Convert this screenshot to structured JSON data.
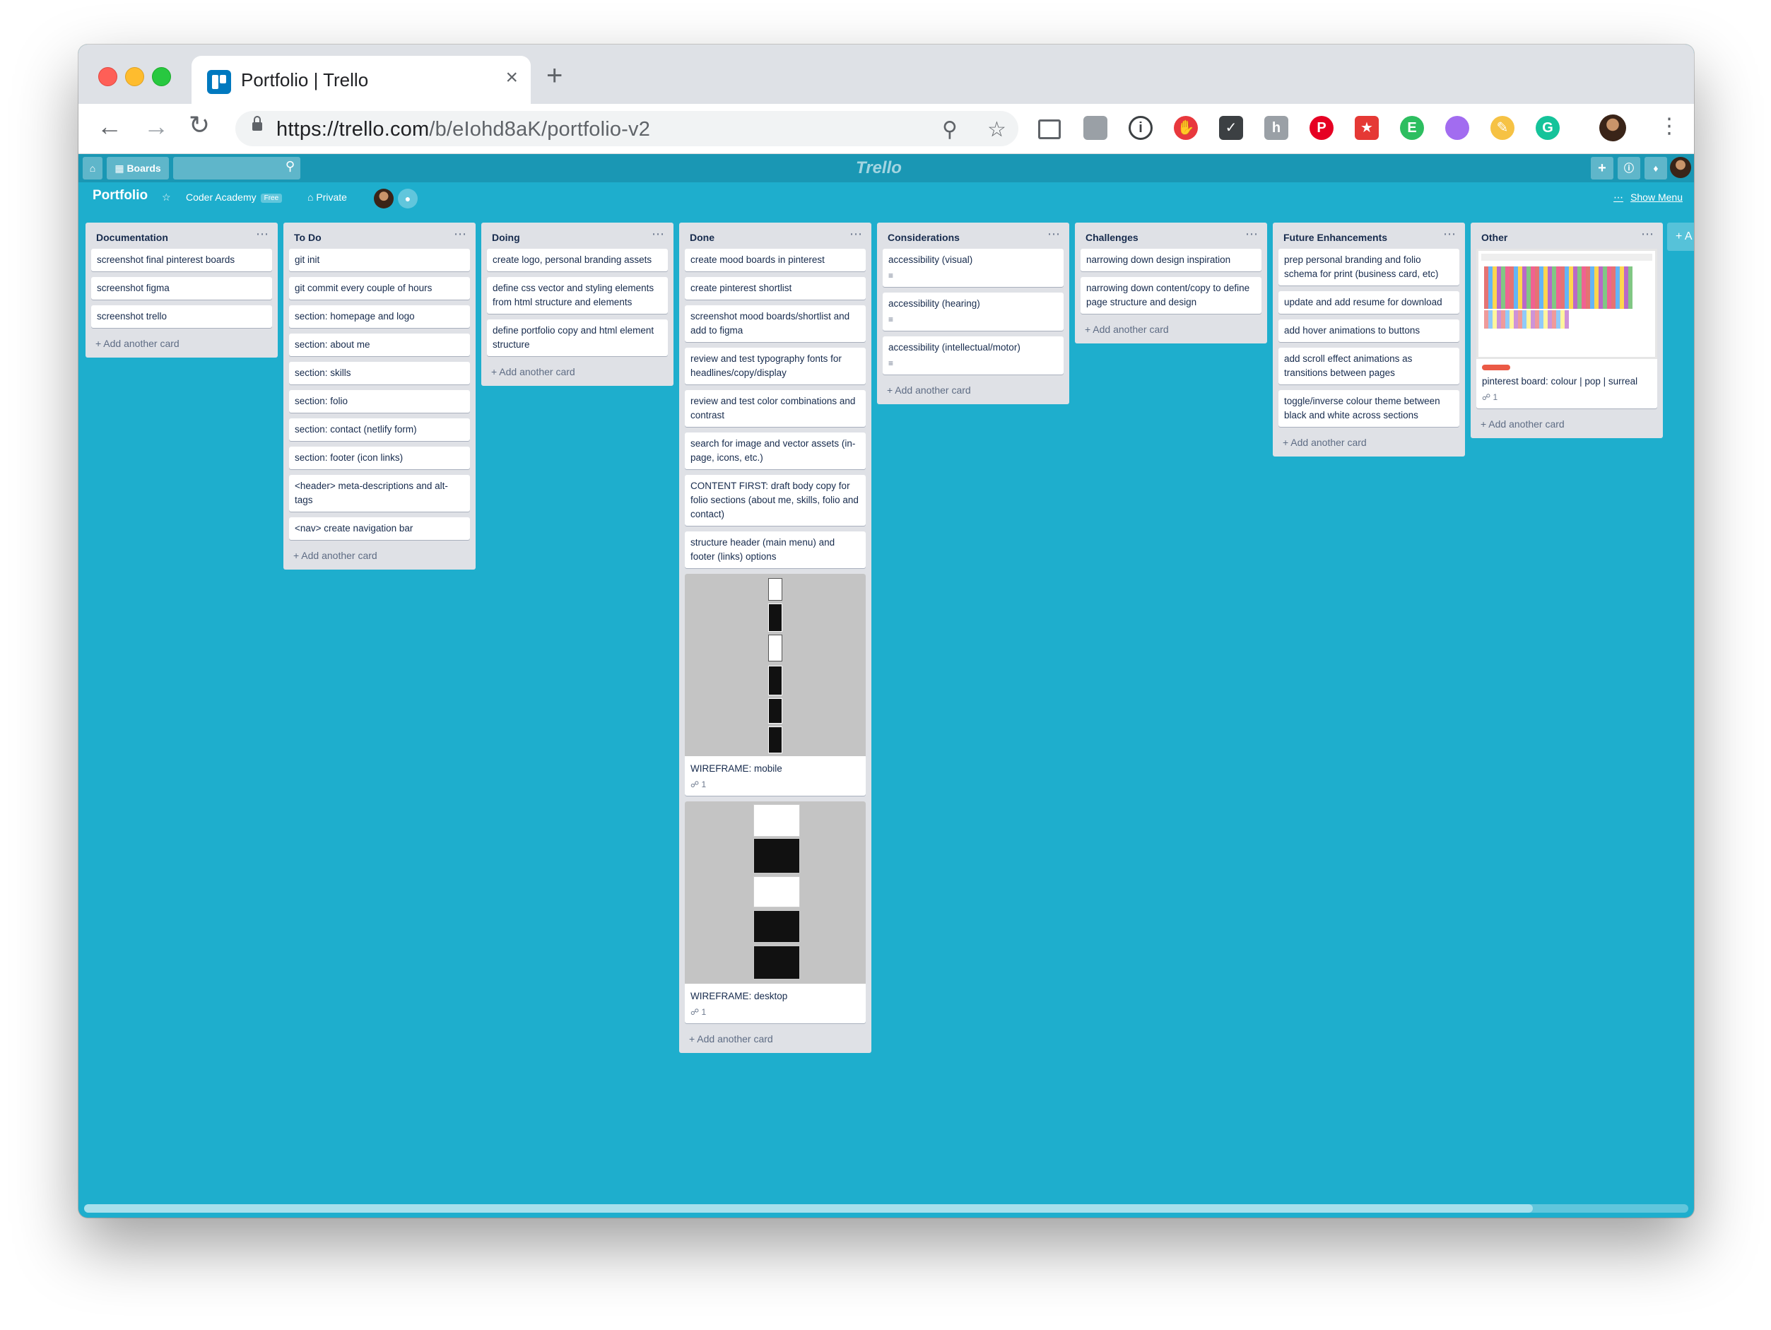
{
  "browser": {
    "tab_title": "Portfolio | Trello",
    "tab_close": "×",
    "new_tab": "+",
    "url_host": "https://trello.com",
    "url_path": "/b/eIohd8aK/portfolio-v2"
  },
  "trello_header": {
    "boards_label": "Boards",
    "logo_text": "Trello"
  },
  "board_header": {
    "title": "Portfolio",
    "team": "Coder Academy",
    "team_badge": "Free",
    "visibility": "Private",
    "show_menu": "Show Menu"
  },
  "lists": [
    {
      "title": "Documentation",
      "cards": [
        {
          "text": "screenshot final pinterest boards"
        },
        {
          "text": "screenshot figma"
        },
        {
          "text": "screenshot trello"
        }
      ],
      "add_card": "+ Add another card"
    },
    {
      "title": "To Do",
      "cards": [
        {
          "text": "git init"
        },
        {
          "text": "git commit every couple of hours"
        },
        {
          "text": "section: homepage and logo"
        },
        {
          "text": "section: about me"
        },
        {
          "text": "section: skills"
        },
        {
          "text": "section: folio"
        },
        {
          "text": "section: contact (netlify form)"
        },
        {
          "text": "section: footer (icon links)"
        },
        {
          "text": "<header> meta-descriptions and alt-tags"
        },
        {
          "text": "<nav> create navigation bar"
        }
      ],
      "add_card": "+ Add another card"
    },
    {
      "title": "Doing",
      "cards": [
        {
          "text": "create logo, personal branding assets"
        },
        {
          "text": "define css vector and styling elements from html structure and elements"
        },
        {
          "text": "define portfolio copy and html element structure"
        }
      ],
      "add_card": "+ Add another card"
    },
    {
      "title": "Done",
      "cards": [
        {
          "text": "create mood boards in pinterest"
        },
        {
          "text": "create pinterest shortlist"
        },
        {
          "text": "screenshot mood boards/shortlist and add to figma"
        },
        {
          "text": "review and test typography fonts for headlines/copy/display"
        },
        {
          "text": "review and test color combinations and contrast"
        },
        {
          "text": "search for image and vector assets (in-page, icons, etc.)"
        },
        {
          "text": "CONTENT FIRST: draft body copy for folio sections (about me, skills, folio and contact)"
        },
        {
          "text": "structure header (main menu) and footer (links) options"
        }
      ],
      "image_cards": [
        {
          "text": "WIREFRAME: mobile",
          "attachments": "1"
        },
        {
          "text": "WIREFRAME: desktop",
          "attachments": "1"
        }
      ],
      "add_card": "+ Add another card"
    },
    {
      "title": "Considerations",
      "cards": [
        {
          "text": "accessibility (visual)",
          "desc_icon": "≡"
        },
        {
          "text": "accessibility (hearing)",
          "desc_icon": "≡"
        },
        {
          "text": "accessibility (intellectual/motor)",
          "desc_icon": "≡"
        }
      ],
      "add_card": "+ Add another card"
    },
    {
      "title": "Challenges",
      "cards": [
        {
          "text": "narrowing down design inspiration"
        },
        {
          "text": "narrowing down content/copy to define page structure and design"
        }
      ],
      "add_card": "+ Add another card"
    },
    {
      "title": "Future Enhancements",
      "cards": [
        {
          "text": "prep personal branding and folio schema for print (business card, etc)"
        },
        {
          "text": "update and add resume for download"
        },
        {
          "text": "add hover animations to buttons"
        },
        {
          "text": "add scroll effect animations as transitions between pages"
        },
        {
          "text": "toggle/inverse colour theme between black and white across sections"
        }
      ],
      "add_card": "+ Add another card"
    },
    {
      "title": "Other",
      "image_card": {
        "text": "pinterest board: colour | pop | surreal",
        "attachments": "1",
        "label_color": "#eb5a46"
      },
      "add_card": "+ Add another card"
    }
  ],
  "add_list": "+ A",
  "colors": {
    "board_bg": "#1eaecd",
    "header_bg": "#1a97b4",
    "list_bg": "#dfe1e6"
  }
}
